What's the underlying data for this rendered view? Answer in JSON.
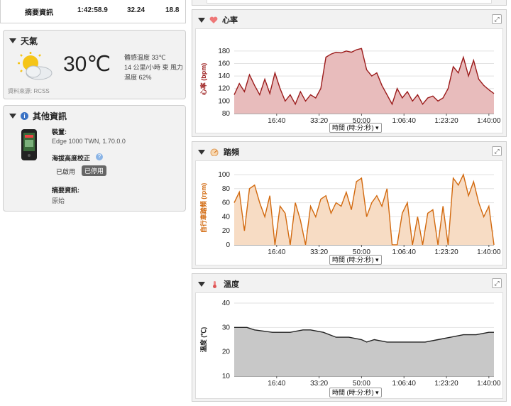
{
  "summary": {
    "label": "摘要資訊",
    "time": "1:42:58.9",
    "value_a": "32.24",
    "value_b": "18.8"
  },
  "weather": {
    "title": "天氣",
    "temperature": "30℃",
    "feels_like": "體感溫度 33℃",
    "wind": "14 公里/小時 東 風力",
    "humidity": "濕度 62%",
    "source": "資料來源: RCSS",
    "icon": "partly-cloudy-icon"
  },
  "other_info": {
    "title": "其他資訊",
    "device_label": "裝置:",
    "device_value": "Edge 1000 TWN, 1.70.0.0",
    "elevation_label": "海拔高度校正",
    "enabled_label": "已啟用",
    "disabled_label": "已停用",
    "summary_label": "摘要資訊:",
    "summary_value": "原始"
  },
  "x_axis_selector": "時間 (時:分:秒)",
  "charts": [
    {
      "title": "心率",
      "icon": "heart-icon",
      "color": "#9b1b1b",
      "fill": "#e8bcbc",
      "ylabel": "心率 (bpm)",
      "y_ticks": [
        "180",
        "160",
        "140",
        "120",
        "100",
        "80"
      ]
    },
    {
      "title": "踏頻",
      "icon": "cadence-icon",
      "color": "#d2690e",
      "fill": "#f7dcc4",
      "ylabel": "自行車踏頻 (rpm)",
      "y_ticks": [
        "100",
        "80",
        "60",
        "40",
        "20",
        "0"
      ]
    },
    {
      "title": "溫度",
      "icon": "thermometer-icon",
      "color": "#222222",
      "fill": "#c8c8c8",
      "ylabel": "溫度 (℃)",
      "y_ticks": [
        "40",
        "30",
        "20",
        "10"
      ]
    }
  ],
  "x_ticks": [
    "16:40",
    "33:20",
    "50:00",
    "1:06:40",
    "1:23:20",
    "1:40:00"
  ],
  "chart_data": [
    {
      "type": "area",
      "title": "心率",
      "ylabel": "心率 (bpm)",
      "xlabel": "時間 (時:分:秒)",
      "ylim": [
        80,
        190
      ],
      "x_unit": "minutes",
      "x": [
        0,
        2,
        4,
        6,
        8,
        10,
        12,
        14,
        16,
        18,
        20,
        22,
        24,
        26,
        28,
        30,
        32,
        34,
        36,
        38,
        40,
        42,
        44,
        46,
        48,
        50,
        52,
        54,
        56,
        58,
        60,
        62,
        64,
        66,
        68,
        70,
        72,
        74,
        76,
        78,
        80,
        82,
        84,
        86,
        88,
        90,
        92,
        94,
        96,
        98,
        100,
        102
      ],
      "values": [
        110,
        128,
        115,
        142,
        125,
        110,
        135,
        112,
        145,
        120,
        100,
        110,
        95,
        115,
        100,
        110,
        105,
        120,
        170,
        175,
        178,
        177,
        180,
        178,
        182,
        184,
        150,
        140,
        145,
        125,
        110,
        95,
        120,
        105,
        115,
        100,
        110,
        95,
        105,
        108,
        100,
        105,
        120,
        155,
        145,
        170,
        140,
        165,
        135,
        125,
        118,
        112
      ],
      "series": [
        {
          "name": "心率",
          "values": [
            110,
            128,
            115,
            142,
            125,
            110,
            135,
            112,
            145,
            120,
            100,
            110,
            95,
            115,
            100,
            110,
            105,
            120,
            170,
            175,
            178,
            177,
            180,
            178,
            182,
            184,
            150,
            140,
            145,
            125,
            110,
            95,
            120,
            105,
            115,
            100,
            110,
            95,
            105,
            108,
            100,
            105,
            120,
            155,
            145,
            170,
            140,
            165,
            135,
            125,
            118,
            112
          ]
        }
      ]
    },
    {
      "type": "area",
      "title": "踏頻",
      "ylabel": "自行車踏頻 (rpm)",
      "xlabel": "時間 (時:分:秒)",
      "ylim": [
        0,
        105
      ],
      "x_unit": "minutes",
      "x": [
        0,
        2,
        4,
        6,
        8,
        10,
        12,
        14,
        16,
        18,
        20,
        22,
        24,
        26,
        28,
        30,
        32,
        34,
        36,
        38,
        40,
        42,
        44,
        46,
        48,
        50,
        52,
        54,
        56,
        58,
        60,
        62,
        64,
        66,
        68,
        70,
        72,
        74,
        76,
        78,
        80,
        82,
        84,
        86,
        88,
        90,
        92,
        94,
        96,
        98,
        100,
        102
      ],
      "values": [
        60,
        75,
        20,
        80,
        85,
        60,
        40,
        70,
        0,
        55,
        45,
        0,
        60,
        35,
        0,
        55,
        40,
        65,
        70,
        45,
        60,
        55,
        75,
        50,
        90,
        95,
        40,
        60,
        70,
        55,
        80,
        0,
        0,
        45,
        60,
        0,
        40,
        0,
        45,
        50,
        0,
        55,
        0,
        95,
        85,
        100,
        70,
        90,
        60,
        40,
        55,
        0
      ],
      "series": [
        {
          "name": "踏頻",
          "values": [
            60,
            75,
            20,
            80,
            85,
            60,
            40,
            70,
            0,
            55,
            45,
            0,
            60,
            35,
            0,
            55,
            40,
            65,
            70,
            45,
            60,
            55,
            75,
            50,
            90,
            95,
            40,
            60,
            70,
            55,
            80,
            0,
            0,
            45,
            60,
            0,
            40,
            0,
            45,
            50,
            0,
            55,
            0,
            95,
            85,
            100,
            70,
            90,
            60,
            40,
            55,
            0
          ]
        }
      ]
    },
    {
      "type": "area",
      "title": "溫度",
      "ylabel": "溫度 (℃)",
      "xlabel": "時間 (時:分:秒)",
      "ylim": [
        10,
        40
      ],
      "x_unit": "minutes",
      "x": [
        0,
        5,
        8,
        15,
        22,
        27,
        30,
        35,
        40,
        45,
        50,
        52,
        55,
        60,
        65,
        70,
        75,
        80,
        85,
        90,
        95,
        100,
        102
      ],
      "values": [
        30,
        30,
        29,
        28,
        28,
        29,
        29,
        28,
        26,
        26,
        25,
        24,
        25,
        24,
        24,
        24,
        24,
        25,
        26,
        27,
        27,
        28,
        28
      ],
      "series": [
        {
          "name": "溫度",
          "values": [
            30,
            30,
            29,
            28,
            28,
            29,
            29,
            28,
            26,
            26,
            25,
            24,
            25,
            24,
            24,
            24,
            24,
            25,
            26,
            27,
            27,
            28,
            28
          ]
        }
      ]
    }
  ]
}
